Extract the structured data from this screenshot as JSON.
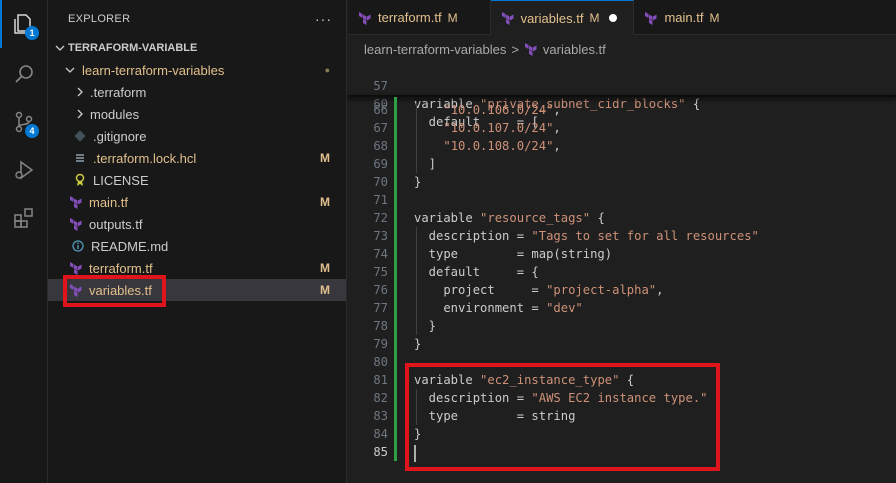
{
  "activity_bar": {
    "explorer_badge": "1",
    "scm_badge": "4"
  },
  "explorer": {
    "title": "EXPLORER",
    "more": "···",
    "workspace": "TERRAFORM-VARIABLE",
    "folder": "learn-terraform-variables",
    "items": [
      {
        "label": "learn-terraform-variables",
        "status": "●"
      },
      {
        "label": ".terraform",
        "status": ""
      },
      {
        "label": "modules",
        "status": ""
      },
      {
        "label": ".gitignore",
        "status": ""
      },
      {
        "label": ".terraform.lock.hcl",
        "status": "M"
      },
      {
        "label": "LICENSE",
        "status": ""
      },
      {
        "label": "main.tf",
        "status": "M"
      },
      {
        "label": "outputs.tf",
        "status": ""
      },
      {
        "label": "README.md",
        "status": ""
      },
      {
        "label": "terraform.tf",
        "status": "M"
      },
      {
        "label": "variables.tf",
        "status": "M"
      }
    ]
  },
  "tabs": [
    {
      "label": "terraform.tf",
      "status": "M"
    },
    {
      "label": "variables.tf",
      "status": "M"
    },
    {
      "label": "main.tf",
      "status": "M"
    }
  ],
  "breadcrumb": {
    "folder": "learn-terraform-variables",
    "sep": ">",
    "file": "variables.tf"
  },
  "code": {
    "sticky": [
      {
        "num": "57",
        "text": "variable \"private_subnet_cidr_blocks\" {"
      },
      {
        "num": "60",
        "text": "  default     = ["
      }
    ],
    "lines": [
      {
        "num": "66",
        "text": "    \"10.0.106.0/24\","
      },
      {
        "num": "67",
        "text": "    \"10.0.107.0/24\","
      },
      {
        "num": "68",
        "text": "    \"10.0.108.0/24\","
      },
      {
        "num": "69",
        "text": "  ]"
      },
      {
        "num": "70",
        "text": "}"
      },
      {
        "num": "71",
        "text": ""
      },
      {
        "num": "72",
        "text": "variable \"resource_tags\" {"
      },
      {
        "num": "73",
        "text": "  description = \"Tags to set for all resources\""
      },
      {
        "num": "74",
        "text": "  type        = map(string)"
      },
      {
        "num": "75",
        "text": "  default     = {"
      },
      {
        "num": "76",
        "text": "    project     = \"project-alpha\","
      },
      {
        "num": "77",
        "text": "    environment = \"dev\""
      },
      {
        "num": "78",
        "text": "  }"
      },
      {
        "num": "79",
        "text": "}"
      },
      {
        "num": "80",
        "text": ""
      },
      {
        "num": "81",
        "text": "variable \"ec2_instance_type\" {"
      },
      {
        "num": "82",
        "text": "  description = \"AWS EC2 instance type.\""
      },
      {
        "num": "83",
        "text": "  type        = string"
      },
      {
        "num": "84",
        "text": "}"
      },
      {
        "num": "85",
        "text": ""
      }
    ]
  },
  "colors": {
    "accent": "#0078d4",
    "modified": "#e2c08d",
    "highlight": "#e0151b",
    "git_added": "#2ea043",
    "terraform": "#844fba"
  }
}
